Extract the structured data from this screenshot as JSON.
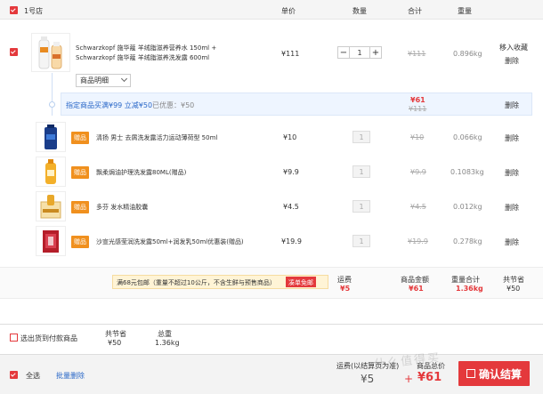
{
  "store": {
    "name": "1号店"
  },
  "headers": {
    "price": "单价",
    "qty": "数量",
    "subtotal": "合计",
    "weight": "重量"
  },
  "main_product": {
    "name": "Schwarzkopf 施华蔻 羊绒脂滋养营养水 150ml + Schwarzkopf 施华蔻 羊绒脂滋养洗发露 600ml",
    "price": "¥111",
    "qty": "1",
    "subtotal": "¥111",
    "weight": "0.896kg",
    "actions": {
      "favorite": "移入收藏",
      "delete": "删除"
    },
    "detail_select": "商品明细",
    "minus": "−",
    "plus": "+"
  },
  "promo": {
    "text": "指定商品买满¥99 立减¥50",
    "discount": "已优惠：¥50",
    "price_now": "¥61",
    "price_orig": "¥111",
    "delete": "删除"
  },
  "gifts": [
    {
      "tag": "赠品",
      "name": "清扬 男士 去屑洗发露活力运动薄荷型 50ml",
      "price": "¥10",
      "qty": "1",
      "subtotal": "¥10",
      "weight": "0.066kg",
      "delete": "删除"
    },
    {
      "tag": "赠品",
      "name": "飘柔焗油护理洗发露80ML(赠品)",
      "price": "¥9.9",
      "qty": "1",
      "subtotal": "¥9.9",
      "weight": "0.1083kg",
      "delete": "删除"
    },
    {
      "tag": "赠品",
      "name": "多芬 发水精油胶囊",
      "price": "¥4.5",
      "qty": "1",
      "subtotal": "¥4.5",
      "weight": "0.012kg",
      "delete": "删除"
    },
    {
      "tag": "赠品",
      "name": "沙宣光感莹润洗发露50ml+润发乳50ml优惠装(赠品)",
      "price": "¥19.9",
      "qty": "1",
      "subtotal": "¥19.9",
      "weight": "0.278kg",
      "delete": "删除"
    }
  ],
  "store_summary": {
    "free_shipping": "满68元包邮（重量不超过10公斤，不含生鲜与预售商品）",
    "free_shipping_btn": "凑单免邮",
    "shipping_label": "运费",
    "shipping_value": "¥5",
    "amount_label": "商品金额",
    "amount_value": "¥61",
    "weight_label": "重量合计",
    "weight_value": "1.36kg",
    "saving_label": "共节省",
    "saving_value": "¥50"
  },
  "selection_bar": {
    "select_label": "选出货到付款商品",
    "saving_label": "共节省",
    "saving_value": "¥50",
    "weight_label": "总重",
    "weight_value": "1.36kg"
  },
  "footer": {
    "select_all": "全选",
    "batch_delete": "批量删除",
    "shipping_label": "运费(以结算页为准)",
    "shipping_value": "¥5",
    "plus": "+",
    "total_label": "商品总价",
    "total_value": "¥61",
    "checkout": "确认结算",
    "watermark": "什么值得买"
  },
  "colors": {
    "accent": "#e4393c",
    "promo_bg": "#eef5ff",
    "gift_tag": "#f0901e",
    "summary_bg": "#fff7e6"
  }
}
